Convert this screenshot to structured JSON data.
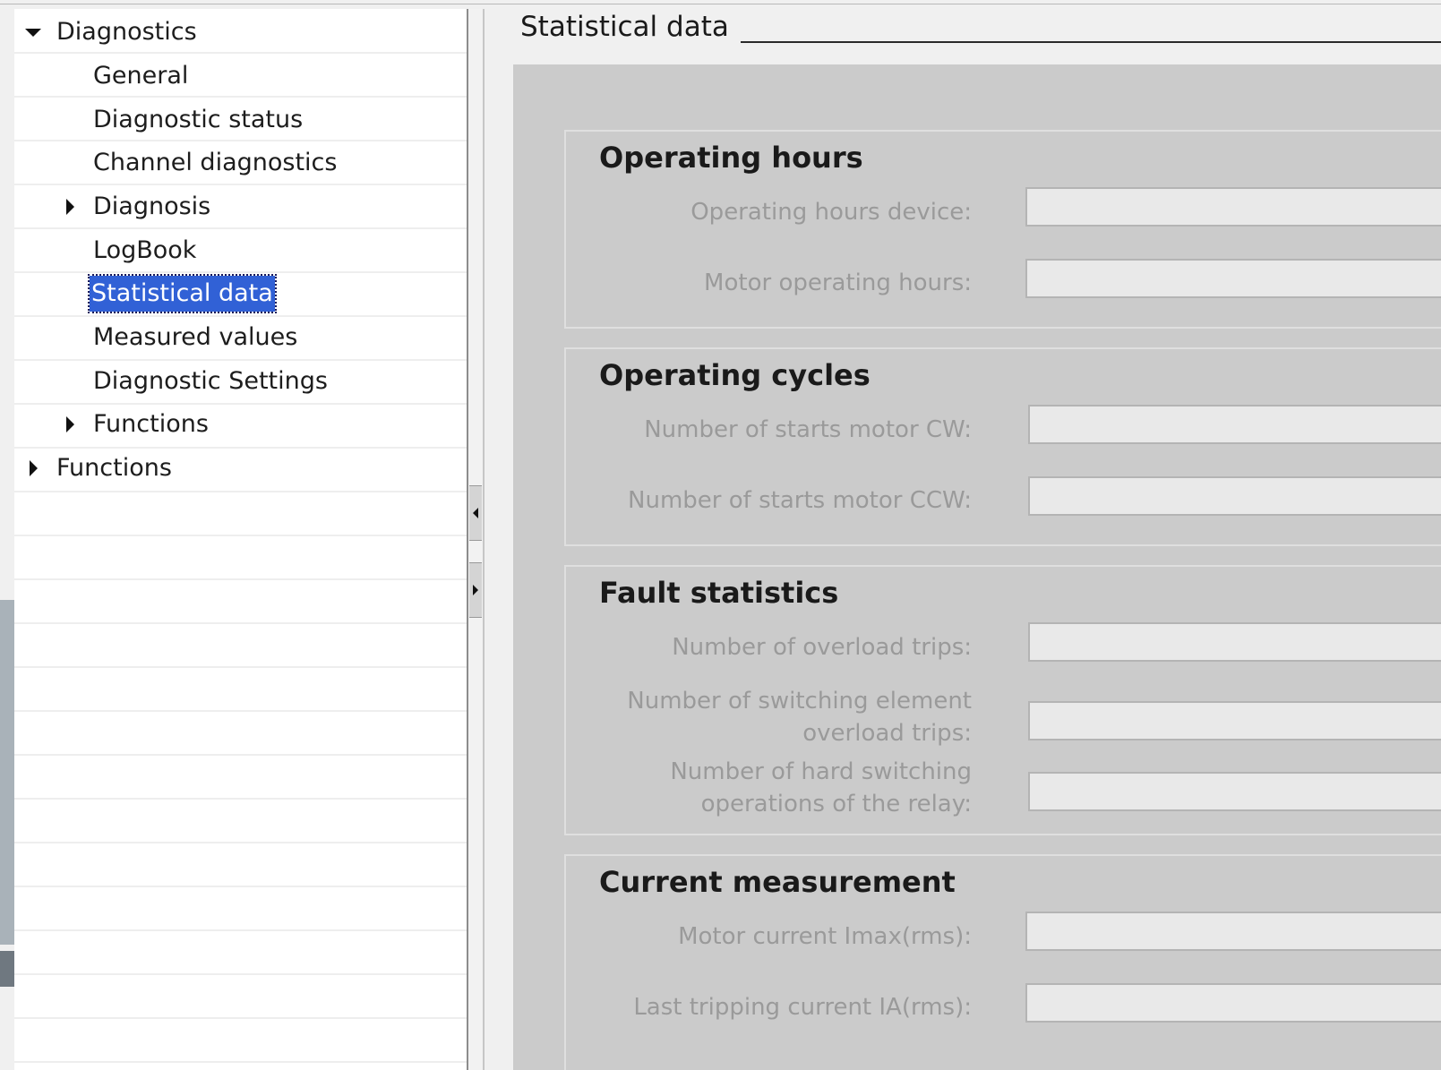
{
  "tree": {
    "root": "Diagnostics",
    "items": [
      {
        "label": "General"
      },
      {
        "label": "Diagnostic status"
      },
      {
        "label": "Channel diagnostics"
      },
      {
        "label": "Diagnosis"
      },
      {
        "label": "LogBook"
      },
      {
        "label": "Statistical data",
        "selected": true
      },
      {
        "label": "Measured values"
      },
      {
        "label": "Diagnostic Settings"
      },
      {
        "label": "Functions"
      }
    ],
    "root2": "Functions"
  },
  "section": {
    "title": "Statistical data"
  },
  "groups": [
    {
      "title": "Operating hours",
      "fields": [
        {
          "label": "Operating hours device:",
          "value": ""
        },
        {
          "label": "Motor operating hours:",
          "value": ""
        }
      ]
    },
    {
      "title": "Operating cycles",
      "fields": [
        {
          "label": "Number of starts motor CW:",
          "value": ""
        },
        {
          "label": "Number of starts motor CCW:",
          "value": ""
        }
      ]
    },
    {
      "title": "Fault statistics",
      "fields": [
        {
          "label": "Number of overload trips:",
          "value": ""
        },
        {
          "label_line1": "Number of switching element",
          "label_line2": "overload trips:",
          "value": ""
        },
        {
          "label_line1": "Number of hard switching",
          "label_line2": "operations of the relay:",
          "value": ""
        }
      ]
    },
    {
      "title": "Current measurement",
      "fields": [
        {
          "label": "Motor current Imax(rms):",
          "value": ""
        },
        {
          "label": "Last tripping current IA(rms):",
          "value": ""
        }
      ]
    }
  ],
  "colors": {
    "selection": "#3161d6",
    "panel": "#cbcbcb",
    "field": "#e9e9e9"
  }
}
